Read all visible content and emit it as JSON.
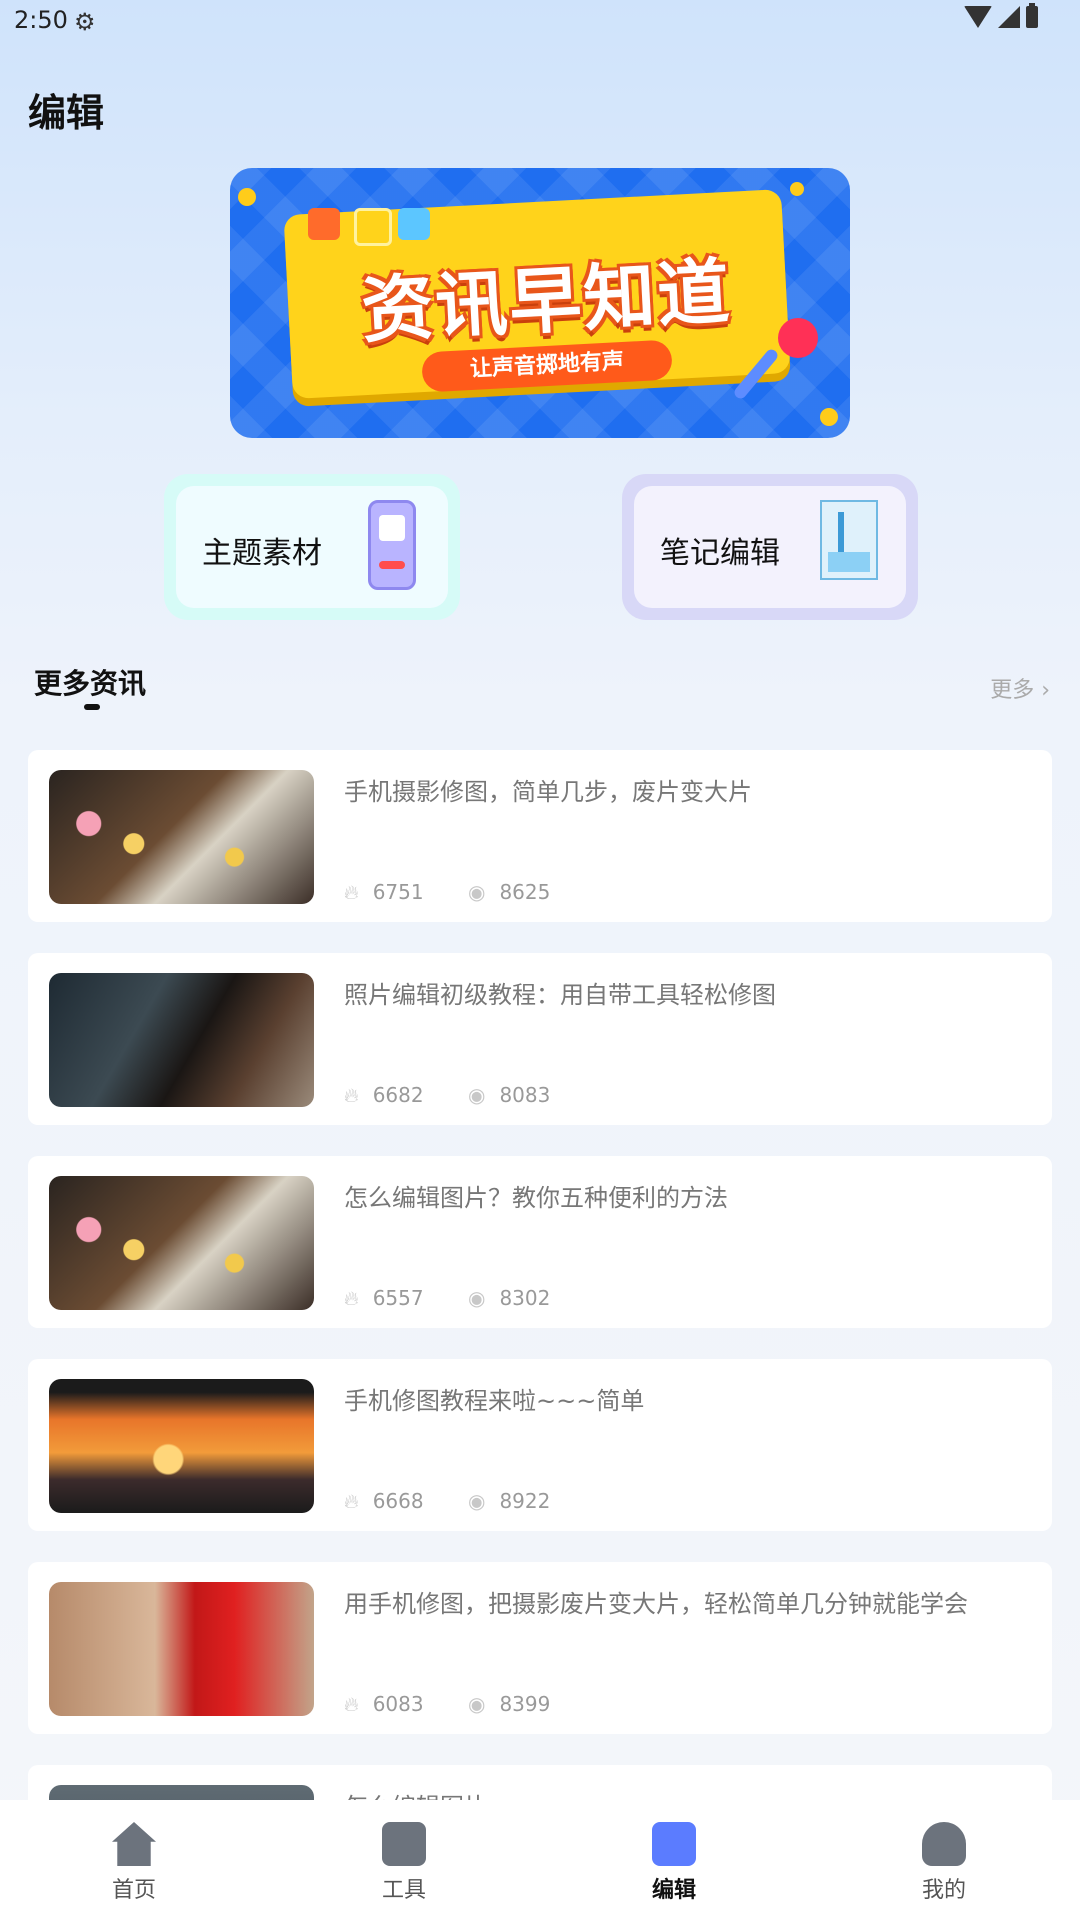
{
  "status": {
    "time": "2:50"
  },
  "header": {
    "title": "编辑"
  },
  "banner": {
    "main": "资讯早知道",
    "sub": "让声音掷地有声"
  },
  "quick": [
    {
      "label": "主题素材"
    },
    {
      "label": "笔记编辑"
    }
  ],
  "section": {
    "title": "更多资讯",
    "more": "更多 ›"
  },
  "articles": [
    {
      "title": "手机摄影修图，简单几步，废片变大片",
      "likes": "6751",
      "views": "8625"
    },
    {
      "title": "照片编辑初级教程：用自带工具轻松修图",
      "likes": "6682",
      "views": "8083"
    },
    {
      "title": "怎么编辑图片？教你五种便利的方法",
      "likes": "6557",
      "views": "8302"
    },
    {
      "title": "手机修图教程来啦~~~简单",
      "likes": "6668",
      "views": "8922"
    },
    {
      "title": "用手机修图，把摄影废片变大片，轻松简单几分钟就能学会",
      "likes": "6083",
      "views": "8399"
    },
    {
      "title": "怎么编辑图片",
      "likes": "",
      "views": ""
    }
  ],
  "tabs": [
    {
      "label": "首页"
    },
    {
      "label": "工具"
    },
    {
      "label": "编辑"
    },
    {
      "label": "我的"
    }
  ],
  "colors": {
    "accent": "#5b7cff",
    "banner_blue": "#1f6ef0",
    "banner_yellow": "#ffd31b"
  }
}
